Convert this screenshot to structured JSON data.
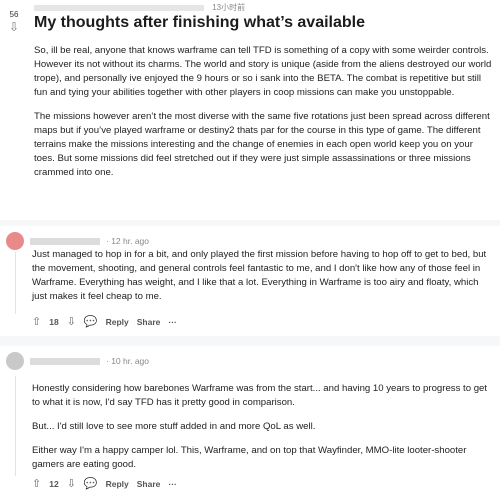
{
  "post": {
    "vote_count": "56",
    "timestamp": "13小时前",
    "title": "My thoughts after finishing what’s available",
    "paragraphs": [
      "So, ill be real, anyone that knows warframe can tell TFD is something of a copy with some weirder controls. However its not without its charms. The world and story is unique (aside from the aliens destroyed our world trope), and personally ive enjoyed the 9 hours or so i sank into the BETA. The combat is repetitive but still fun and tying your abilities together with other players in coop missions can make you unstoppable.",
      "The missions however aren’t the most diverse with the same five rotations just been spread across different maps but if you’ve played warframe or destiny2 thats par for the course in this type of game. The different terrains make the missions interesting and the change of enemies in each open world keep you on your toes. But some missions did feel stretched out if they were just simple assassinations or three missions crammed into one."
    ]
  },
  "comments": [
    {
      "time": "· 12 hr. ago",
      "paragraphs": [
        "Just managed to hop in for a bit, and only played the first mission before having to hop off to get to bed, but the movement, shooting, and general controls feel fantastic to me, and I don't like how any of those feel in Warframe. Everything has weight, and I like that a lot. Everything in Warframe is too airy and floaty, which just makes it feel cheap to me."
      ],
      "votes": "18",
      "reply": "Reply",
      "share": "Share",
      "more": "···"
    },
    {
      "time": "· 10 hr. ago",
      "paragraphs": [
        "Honestly considering how barebones Warframe was from the start... and having 10 years to progress to get to what it is now, I'd say TFD has it pretty good in comparison.",
        "But... I'd still love to see more stuff added in and more QoL as well.",
        "Either way I'm a happy camper lol. This, Warframe, and on top that Wayfinder, MMO-lite looter-shooter gamers are eating good."
      ],
      "votes": "12",
      "reply": "Reply",
      "share": "Share",
      "more": "···"
    }
  ],
  "icons": {
    "upvote": "upvote-icon",
    "downvote": "downvote-icon",
    "reply": "reply-icon"
  }
}
